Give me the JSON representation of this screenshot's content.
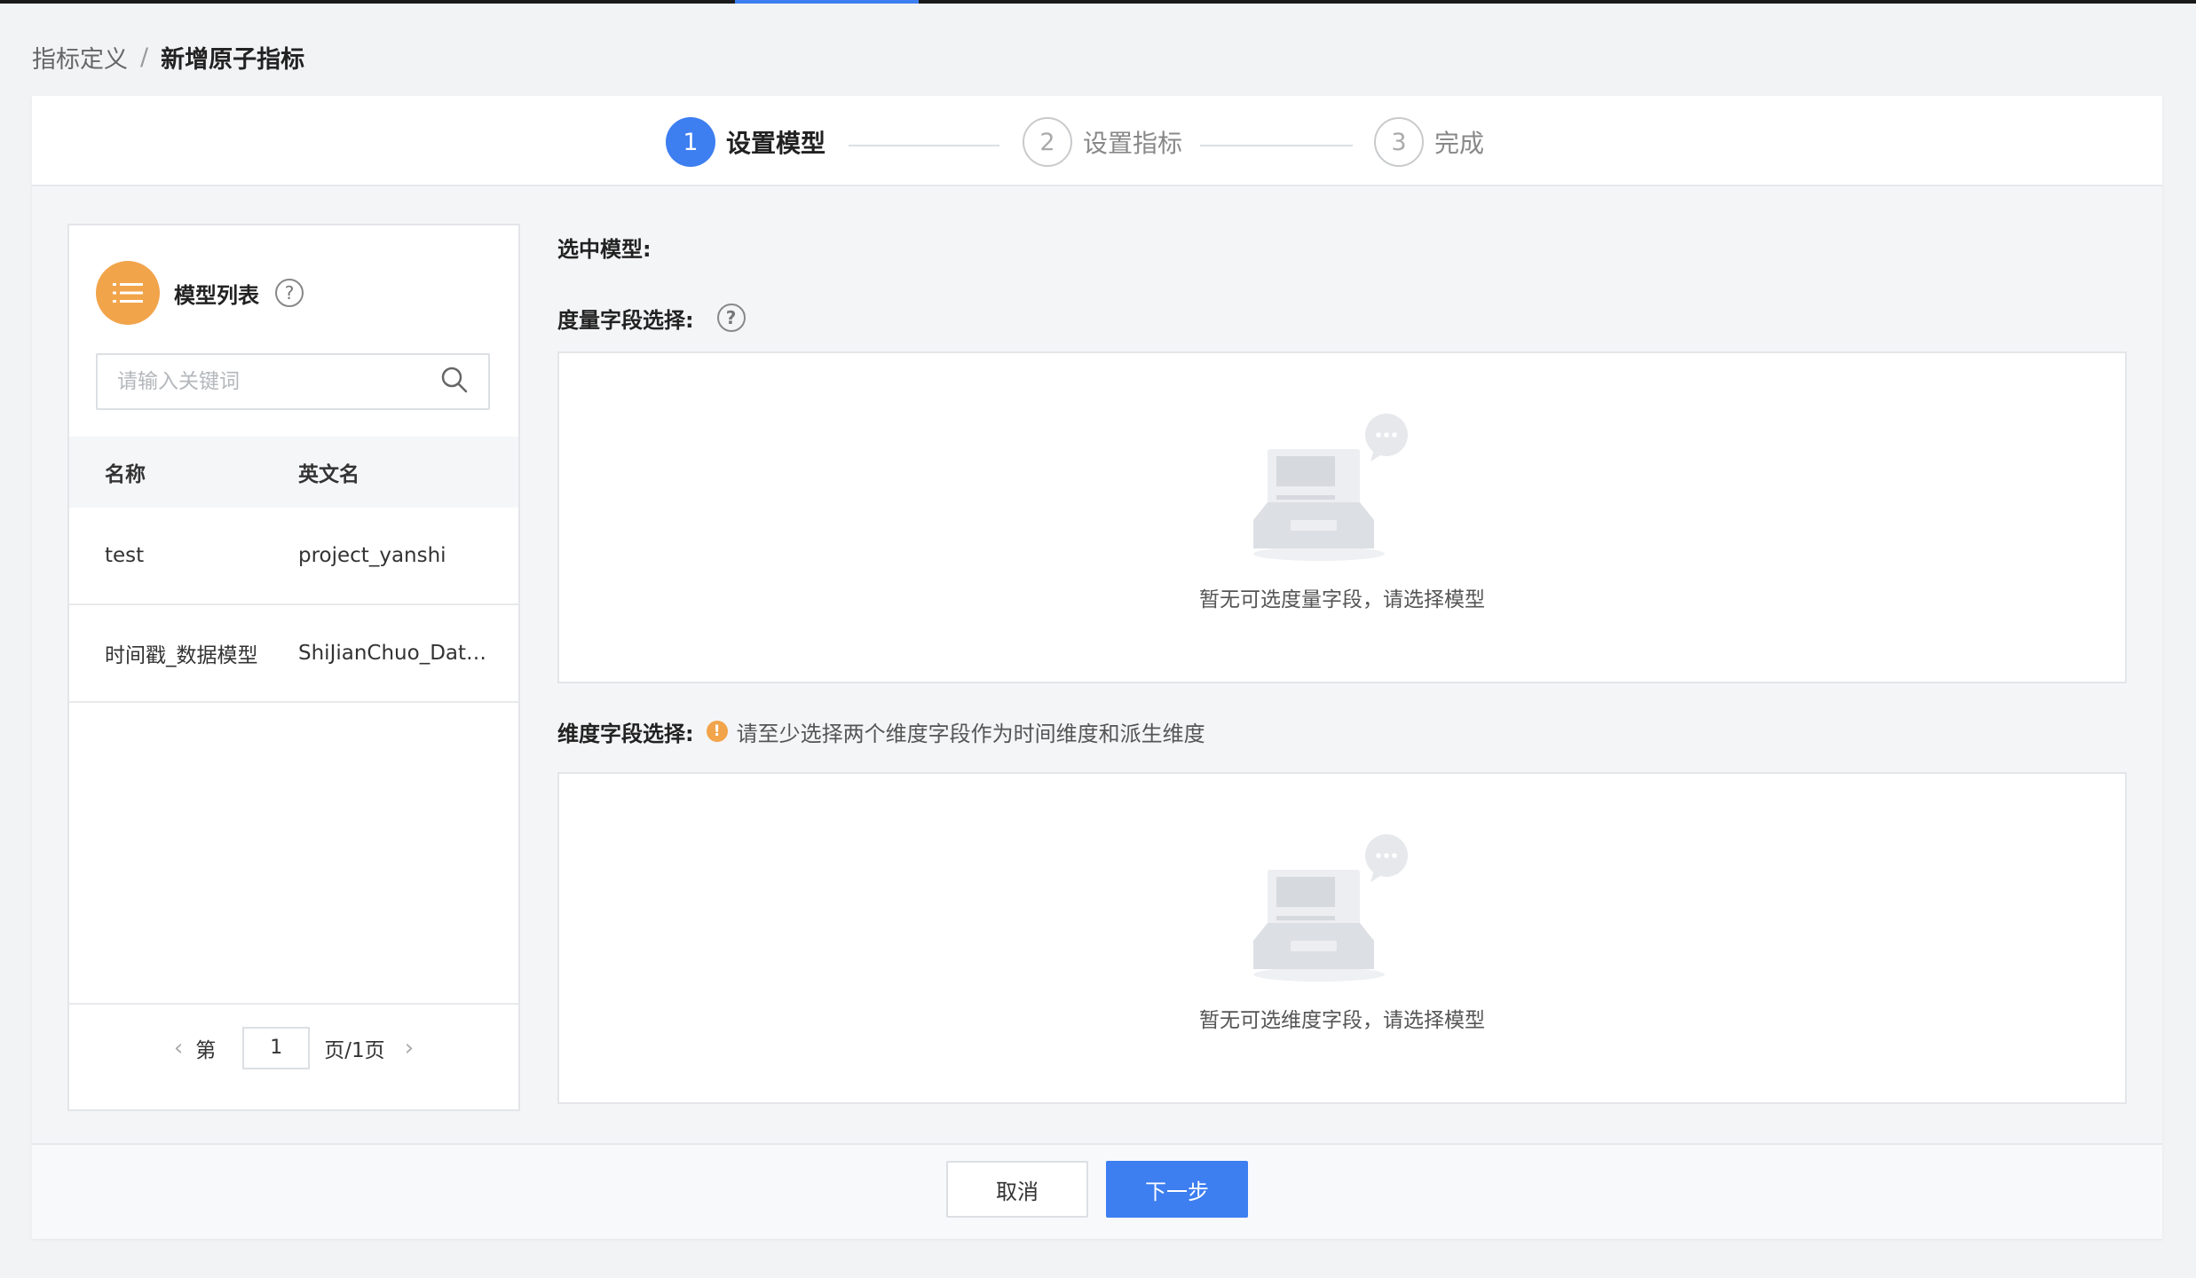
{
  "breadcrumb": {
    "parent": "指标定义",
    "separator": "/",
    "current": "新增原子指标"
  },
  "steps": [
    {
      "num": "1",
      "label": "设置模型",
      "state": "active"
    },
    {
      "num": "2",
      "label": "设置指标",
      "state": "todo"
    },
    {
      "num": "3",
      "label": "完成",
      "state": "todo"
    }
  ],
  "model_list": {
    "title": "模型列表",
    "search_placeholder": "请输入关键词",
    "columns": {
      "name": "名称",
      "english": "英文名"
    },
    "rows": [
      {
        "name": "test",
        "english": "project_yanshi"
      },
      {
        "name": "时间戳_数据模型",
        "english": "ShiJianChuo_DataModel"
      }
    ],
    "pager": {
      "prefix": "第",
      "page": "1",
      "suffix": "页/1页"
    }
  },
  "main": {
    "selected_model_label": "选中模型:",
    "measure_label": "度量字段选择:",
    "measure_empty": "暂无可选度量字段，请选择模型",
    "dimension_label": "维度字段选择:",
    "dimension_hint": "请至少选择两个维度字段作为时间维度和派生维度",
    "dimension_empty": "暂无可选维度字段，请选择模型"
  },
  "footer": {
    "cancel_label": "取消",
    "next_label": "下一步"
  },
  "colors": {
    "primary": "#3d7ef0",
    "warning": "#f2a44b"
  }
}
